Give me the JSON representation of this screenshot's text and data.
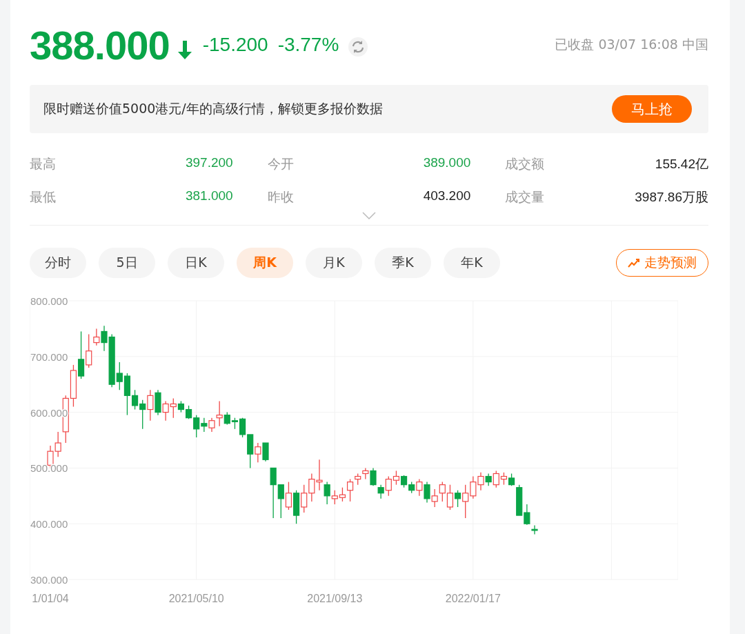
{
  "quote": {
    "price": "388.000",
    "change": "-15.200",
    "change_pct": "-3.77%",
    "status": "已收盘 03/07 16:08 中国"
  },
  "promo": {
    "text": "限时赠送价值5000港元/年的高级行情，解锁更多报价数据",
    "button": "马上抢"
  },
  "stats": [
    {
      "label": "最高",
      "value": "397.200",
      "color": "#1aa34a"
    },
    {
      "label": "今开",
      "value": "389.000",
      "color": "#1aa34a"
    },
    {
      "label": "成交额",
      "value": "155.42亿",
      "color": "#222222"
    },
    {
      "label": "最低",
      "value": "381.000",
      "color": "#1aa34a"
    },
    {
      "label": "昨收",
      "value": "403.200",
      "color": "#222222"
    },
    {
      "label": "成交量",
      "value": "3987.86万股",
      "color": "#222222"
    }
  ],
  "tabs": [
    {
      "label": "分时",
      "selected": false
    },
    {
      "label": "5日",
      "selected": false
    },
    {
      "label": "日K",
      "selected": false
    },
    {
      "label": "周K",
      "selected": true
    },
    {
      "label": "月K",
      "selected": false
    },
    {
      "label": "季K",
      "selected": false
    },
    {
      "label": "年K",
      "selected": false
    }
  ],
  "forecast_button": "走势预测",
  "chart": {
    "chart_data": {
      "type": "candlestick",
      "grid": true,
      "ylim": [
        300,
        800
      ],
      "yticks": [
        {
          "value": 800,
          "label": "800.000"
        },
        {
          "value": 700,
          "label": "700.000"
        },
        {
          "value": 600,
          "label": "600.000"
        },
        {
          "value": 500,
          "label": "500.000"
        },
        {
          "value": 400,
          "label": "400.000"
        },
        {
          "value": 300,
          "label": "300.000"
        }
      ],
      "categories": [
        "1/01/04",
        null,
        null,
        null,
        null,
        null,
        null,
        null,
        null,
        null,
        null,
        null,
        null,
        null,
        null,
        null,
        null,
        null,
        null,
        "2021/05/10",
        null,
        null,
        null,
        null,
        null,
        null,
        null,
        null,
        null,
        null,
        null,
        null,
        null,
        null,
        null,
        null,
        null,
        "2021/09/13",
        null,
        null,
        null,
        null,
        null,
        null,
        null,
        null,
        null,
        null,
        null,
        null,
        null,
        null,
        null,
        null,
        null,
        "2022/01/17",
        null,
        null,
        null,
        null,
        null,
        null,
        null,
        null
      ],
      "ohlc": [
        [
          505,
          540,
          500,
          530
        ],
        [
          530,
          565,
          520,
          545
        ],
        [
          565,
          630,
          545,
          625
        ],
        [
          625,
          685,
          610,
          675
        ],
        [
          695,
          745,
          660,
          665
        ],
        [
          685,
          740,
          680,
          710
        ],
        [
          725,
          750,
          720,
          735
        ],
        [
          745,
          755,
          710,
          725
        ],
        [
          735,
          740,
          645,
          650
        ],
        [
          670,
          690,
          640,
          655
        ],
        [
          665,
          670,
          595,
          630
        ],
        [
          630,
          640,
          605,
          612
        ],
        [
          615,
          622,
          570,
          605
        ],
        [
          605,
          640,
          585,
          630
        ],
        [
          635,
          640,
          595,
          600
        ],
        [
          600,
          620,
          585,
          615
        ],
        [
          610,
          625,
          590,
          615
        ],
        [
          615,
          620,
          600,
          605
        ],
        [
          605,
          612,
          588,
          590
        ],
        [
          590,
          595,
          555,
          570
        ],
        [
          580,
          590,
          565,
          575
        ],
        [
          572,
          590,
          565,
          585
        ],
        [
          590,
          620,
          575,
          595
        ],
        [
          595,
          600,
          578,
          580
        ],
        [
          585,
          590,
          570,
          583
        ],
        [
          588,
          590,
          555,
          560
        ],
        [
          560,
          560,
          500,
          525
        ],
        [
          525,
          545,
          510,
          538
        ],
        [
          545,
          545,
          512,
          515
        ],
        [
          500,
          500,
          410,
          470
        ],
        [
          470,
          470,
          410,
          445
        ],
        [
          430,
          475,
          425,
          455
        ],
        [
          455,
          460,
          400,
          415
        ],
        [
          430,
          470,
          420,
          455
        ],
        [
          455,
          490,
          440,
          480
        ],
        [
          475,
          515,
          460,
          478
        ],
        [
          470,
          475,
          435,
          450
        ],
        [
          445,
          460,
          435,
          450
        ],
        [
          447,
          465,
          440,
          452
        ],
        [
          460,
          480,
          440,
          475
        ],
        [
          480,
          490,
          470,
          485
        ],
        [
          490,
          500,
          480,
          495
        ],
        [
          495,
          500,
          468,
          470
        ],
        [
          465,
          470,
          445,
          455
        ],
        [
          460,
          485,
          450,
          480
        ],
        [
          478,
          495,
          470,
          485
        ],
        [
          485,
          487,
          465,
          470
        ],
        [
          470,
          475,
          455,
          460
        ],
        [
          460,
          480,
          450,
          475
        ],
        [
          470,
          475,
          438,
          445
        ],
        [
          440,
          462,
          430,
          450
        ],
        [
          455,
          475,
          440,
          470
        ],
        [
          430,
          470,
          425,
          455
        ],
        [
          455,
          460,
          430,
          445
        ],
        [
          440,
          470,
          410,
          455
        ],
        [
          450,
          485,
          445,
          475
        ],
        [
          470,
          492,
          460,
          485
        ],
        [
          485,
          490,
          468,
          475
        ],
        [
          470,
          495,
          465,
          490
        ],
        [
          480,
          492,
          470,
          485
        ],
        [
          482,
          490,
          468,
          470
        ],
        [
          465,
          470,
          415,
          415
        ],
        [
          420,
          435,
          398,
          400
        ],
        [
          390,
          397,
          381,
          388
        ]
      ]
    }
  }
}
